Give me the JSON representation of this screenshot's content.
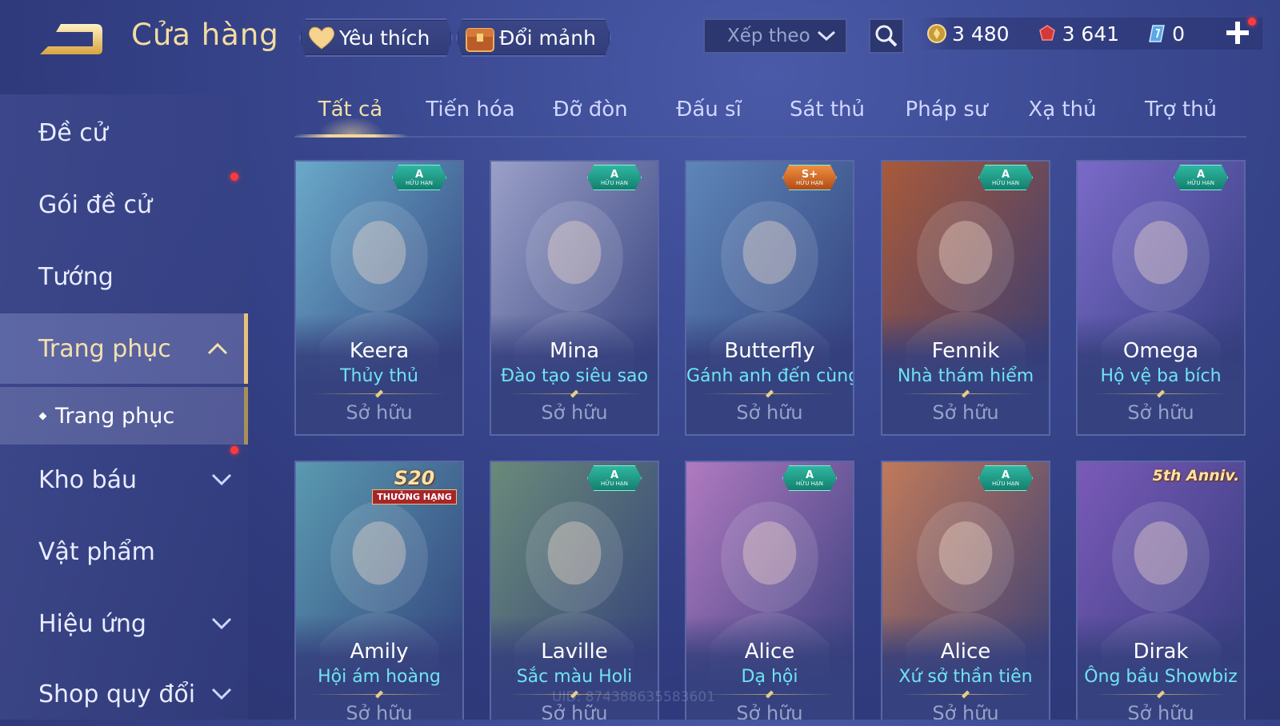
{
  "header": {
    "title": "Cửa hàng",
    "favorite_label": "Yêu thích",
    "fragment_label": "Đổi mảnh",
    "sort_placeholder": "Xếp theo"
  },
  "currency": {
    "gold": "3 480",
    "ruby": "3 641",
    "voucher": "0"
  },
  "sidebar": {
    "items": [
      {
        "label": "Đề cử"
      },
      {
        "label": "Gói đề cử"
      },
      {
        "label": "Tướng"
      },
      {
        "label": "Trang phục"
      },
      {
        "label": "Kho báu"
      },
      {
        "label": "Vật phẩm"
      },
      {
        "label": "Hiệu ứng"
      },
      {
        "label": "Shop quy đổi"
      }
    ],
    "sub_item": "Trang phục"
  },
  "tabs": [
    "Tất cả",
    "Tiến hóa",
    "Đỡ đòn",
    "Đấu sĩ",
    "Sát thủ",
    "Pháp sư",
    "Xạ thủ",
    "Trợ thủ"
  ],
  "cards": [
    {
      "hero": "Keera",
      "skin": "Thủy thủ",
      "status": "Sở hữu",
      "badge_grade": "A",
      "badge_text": "HỮU HẠN",
      "color": "#6aa9c9"
    },
    {
      "hero": "Mina",
      "skin": "Đào tạo siêu sao",
      "status": "Sở hữu",
      "badge_grade": "A",
      "badge_text": "HỮU HẠN",
      "color": "#9aa0c8"
    },
    {
      "hero": "Butterfly",
      "skin": "Gánh anh đến cùng",
      "status": "Sở hữu",
      "badge_grade": "S+",
      "badge_text": "HỮU HẠN",
      "color": "#5e86b8"
    },
    {
      "hero": "Fennik",
      "skin": "Nhà thám hiểm",
      "status": "Sở hữu",
      "badge_grade": "A",
      "badge_text": "HỮU HẠN",
      "color": "#a85a3a"
    },
    {
      "hero": "Omega",
      "skin": "Hộ vệ ba bích",
      "status": "Sở hữu",
      "badge_grade": "A",
      "badge_text": "HỮU HẠN",
      "color": "#7a6ac8"
    },
    {
      "hero": "Amily",
      "skin": "Hội ám hoàng",
      "status": "Sở hữu",
      "ribbon_top": "S20",
      "ribbon_bottom": "THƯỞNG HẠNG",
      "color": "#5a9ab0"
    },
    {
      "hero": "Laville",
      "skin": "Sắc màu Holi",
      "status": "Sở hữu",
      "badge_grade": "A",
      "badge_text": "HỮU HẠN",
      "color": "#6a8a7a"
    },
    {
      "hero": "Alice",
      "skin": "Dạ hội",
      "status": "Sở hữu",
      "badge_grade": "A",
      "badge_text": "HỮU HẠN",
      "color": "#b07ac0"
    },
    {
      "hero": "Alice",
      "skin": "Xứ sở thần tiên",
      "status": "Sở hữu",
      "badge_grade": "A",
      "badge_text": "HỮU HẠN",
      "color": "#c07a5a"
    },
    {
      "hero": "Dirak",
      "skin": "Ông bầu Showbiz",
      "status": "Sở hữu",
      "ribbon_top": "5th Anniv.",
      "color": "#7a5ab8"
    }
  ],
  "watermark": "UID: 874388635583601"
}
